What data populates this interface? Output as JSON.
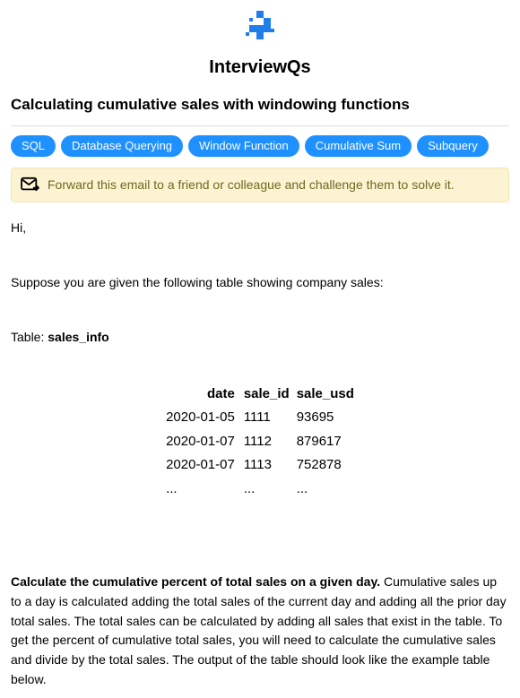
{
  "brand": "InterviewQs",
  "title": "Calculating cumulative sales with windowing functions",
  "tags": [
    "SQL",
    "Database Querying",
    "Window Function",
    "Cumulative Sum",
    "Subquery"
  ],
  "banner": {
    "text": "Forward this email to a friend or colleague and challenge them to solve it."
  },
  "greeting": "Hi,",
  "intro": "Suppose you are given the following table showing company sales:",
  "table_label_prefix": "Table: ",
  "table_name": "sales_info",
  "table": {
    "headers": [
      "date",
      "sale_id",
      "sale_usd"
    ],
    "rows": [
      [
        "2020-01-05",
        "1111",
        "93695"
      ],
      [
        "2020-01-07",
        "1112",
        "879617"
      ],
      [
        "2020-01-07",
        "1113",
        "752878"
      ],
      [
        "...",
        "...",
        "..."
      ]
    ]
  },
  "question": {
    "lead": "Calculate the cumulative percent of total sales on a given day.",
    "rest": " Cumulative sales up to a day is calculated adding the total sales of the current day and adding all the prior day total sales. The total sales can be calculated by adding all sales that exist in the table. To get the percent of cumulative total sales, you will need to calculate the cumulative sales and divide by the total sales. The output of the table should look like the example table below."
  }
}
